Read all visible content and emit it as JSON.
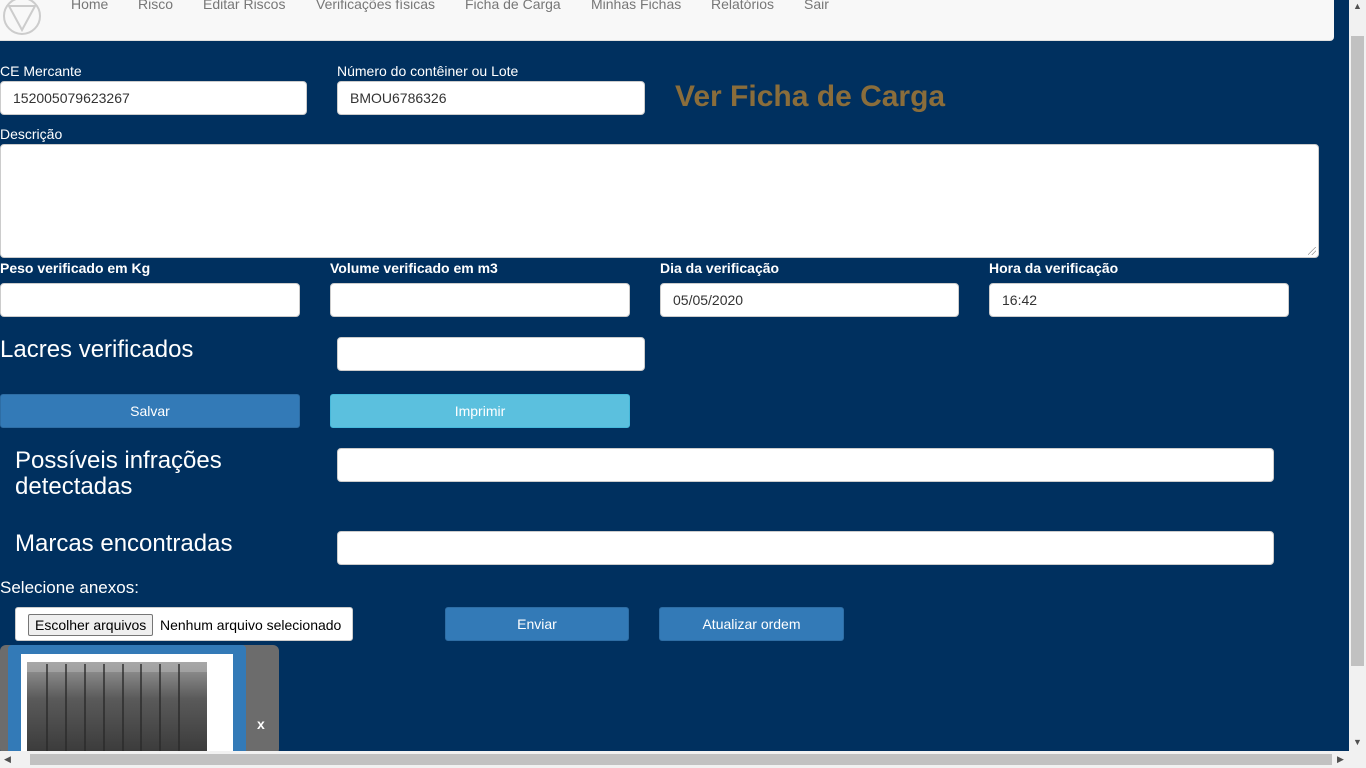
{
  "navbar": {
    "items": [
      "Home",
      "Risco",
      "Editar Riscos",
      "Verificações físicas",
      "Ficha de Carga",
      "Minhas Fichas",
      "Relatórios",
      "Sair"
    ]
  },
  "form": {
    "ce_label": "CE Mercante",
    "ce_value": "152005079623267",
    "container_label": "Número do contêiner ou Lote",
    "container_value": "BMOU6786326",
    "ver_ficha_link": "Ver Ficha de Carga",
    "descricao_label": "Descrição",
    "descricao_value": "",
    "peso_label": "Peso verificado em Kg",
    "peso_value": "",
    "volume_label": "Volume verificado em m3",
    "volume_value": "",
    "dia_label": "Dia da verificação",
    "dia_value": "05/05/2020",
    "hora_label": "Hora da verificação",
    "hora_value": "16:42",
    "lacres_label": "Lacres verificados",
    "lacres_value": "",
    "salvar_button": "Salvar",
    "imprimir_button": "Imprimir",
    "infracoes_label": "Possíveis infrações detectadas",
    "infracoes_value": "",
    "marcas_label": "Marcas encontradas",
    "marcas_value": ""
  },
  "anexos": {
    "label": "Selecione anexos:",
    "choose_button": "Escolher arquivos",
    "file_status": "Nenhum arquivo selecionado",
    "enviar_button": "Enviar",
    "atualizar_button": "Atualizar ordem",
    "remove_label": "x"
  },
  "colors": {
    "background": "#00305f",
    "primary": "#337ab7",
    "info": "#5bc0de",
    "link_gold": "#8a6d3b"
  }
}
